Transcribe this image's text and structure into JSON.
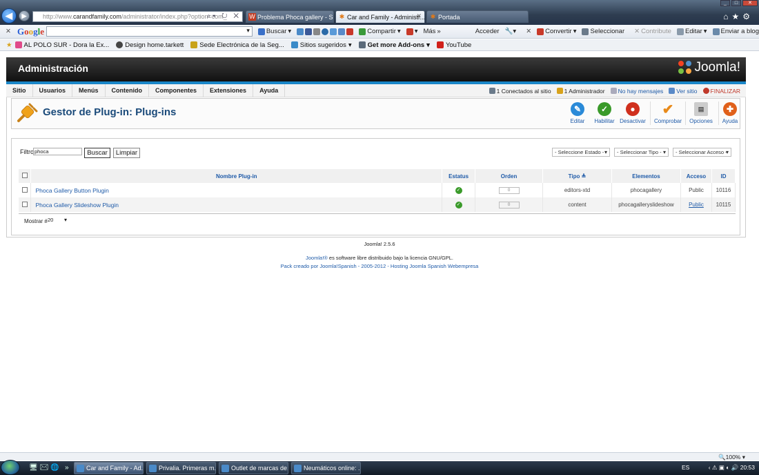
{
  "browser": {
    "url_host": "http://www.",
    "url_domain": "carandfamily.com",
    "url_path": "/administrator/index.php?option=com_",
    "tabs": [
      {
        "label": "Problema Phoca gallery - Servi..."
      },
      {
        "label": "Car and Family - Administr..."
      },
      {
        "label": "Portada"
      }
    ],
    "toolbar": {
      "google_search_label": "Buscar",
      "share_label": "Compartir",
      "more_label": "Más",
      "login_label": "Acceder",
      "convert_label": "Convertir",
      "select_label": "Seleccionar",
      "contribute_label": "Contribute",
      "edit_label": "Editar",
      "send_label": "Enviar a blog"
    },
    "bookmarks": [
      "AL POLO SUR - Dora la Ex...",
      "Design  home.tarkett",
      "Sede Electrónica de la Seg...",
      "Sitios sugeridos",
      "Get more Add-ons",
      "YouTube"
    ],
    "zoom": "100%"
  },
  "admin": {
    "header_title": "Administración",
    "brand": "Joomla!",
    "menu": [
      "Sitio",
      "Usuarios",
      "Menús",
      "Contenido",
      "Componentes",
      "Extensiones",
      "Ayuda"
    ],
    "status": {
      "connected": "1 Conectados al sitio",
      "admins": "1 Administrador",
      "messages": "No hay mensajes",
      "view_site": "Ver sitio",
      "logout": "FINALIZAR"
    },
    "page_title": "Gestor de Plug-in: Plug-ins",
    "toolbar_buttons": [
      {
        "label": "Editar",
        "color": "#2a8ad8",
        "icon": "edit-icon"
      },
      {
        "label": "Habilitar",
        "color": "#3a9a2a",
        "icon": "check-icon"
      },
      {
        "label": "Desactivar",
        "color": "#d0301e",
        "icon": "disable-icon"
      },
      {
        "label": "Comprobar",
        "color": "#e88a1a",
        "icon": "checkmark-icon"
      },
      {
        "label": "Opciones",
        "color": "#888888",
        "icon": "options-icon"
      },
      {
        "label": "Ayuda",
        "color": "#e0601a",
        "icon": "help-icon"
      }
    ]
  },
  "filters": {
    "label": "Filtro",
    "value": "phoca",
    "search_button": "Buscar",
    "clear_button": "Limpiar",
    "state_select": "- Seleccione Estado -",
    "type_select": "- Seleccionar Tipo -",
    "access_select": "- Seleccionar Acceso -"
  },
  "table": {
    "columns": [
      "Nombre Plug-in",
      "Estatus",
      "Orden",
      "Tipo",
      "Elementos",
      "Acceso",
      "ID"
    ],
    "rows": [
      {
        "name": "Phoca Gallery Button Plugin",
        "status": "enabled",
        "order": "0",
        "type": "editors-xtd",
        "element": "phocagallery",
        "access": "Public",
        "id": "10116"
      },
      {
        "name": "Phoca Gallery Slideshow Plugin",
        "status": "enabled",
        "order": "0",
        "type": "content",
        "element": "phocagalleryslideshow",
        "access": "Public",
        "id": "10115"
      }
    ],
    "show_label": "Mostrar #",
    "show_value": "20"
  },
  "footer": {
    "version": "Joomla! 2.5.6",
    "license_link": "Joomla!®",
    "license_text": " es software libre distribuido bajo la licencia GNU/GPL.",
    "pack": "Pack creado por Joomla!Spanish - 2005-2012 - Hosting Joomla Spanish Webempresa"
  },
  "taskbar": {
    "tasks": [
      "Car and Family - Ad...",
      "Privalia. Primeras m...",
      "Outlet de marcas de...",
      "Neumáticos online: ..."
    ],
    "lang": "ES",
    "time": "20:53"
  }
}
